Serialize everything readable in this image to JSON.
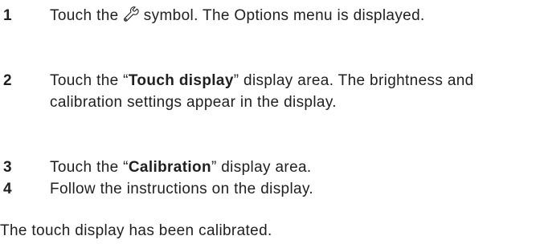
{
  "steps": [
    {
      "number": "1",
      "text_before_icon": "Touch the ",
      "icon": "wrench-icon",
      "text_after_icon": " symbol. The Options menu is displayed."
    },
    {
      "number": "2",
      "text_before_bold": "Touch the “",
      "bold": "Touch display",
      "text_after_bold": "” display area. The brightness and calibration settings appear in the display."
    },
    {
      "number": "3",
      "text_before_bold": "Touch the “",
      "bold": "Calibration",
      "text_after_bold": "” display area."
    },
    {
      "number": "4",
      "text": "Follow the instructions on the display."
    }
  ],
  "result": "The touch display has been calibrated."
}
